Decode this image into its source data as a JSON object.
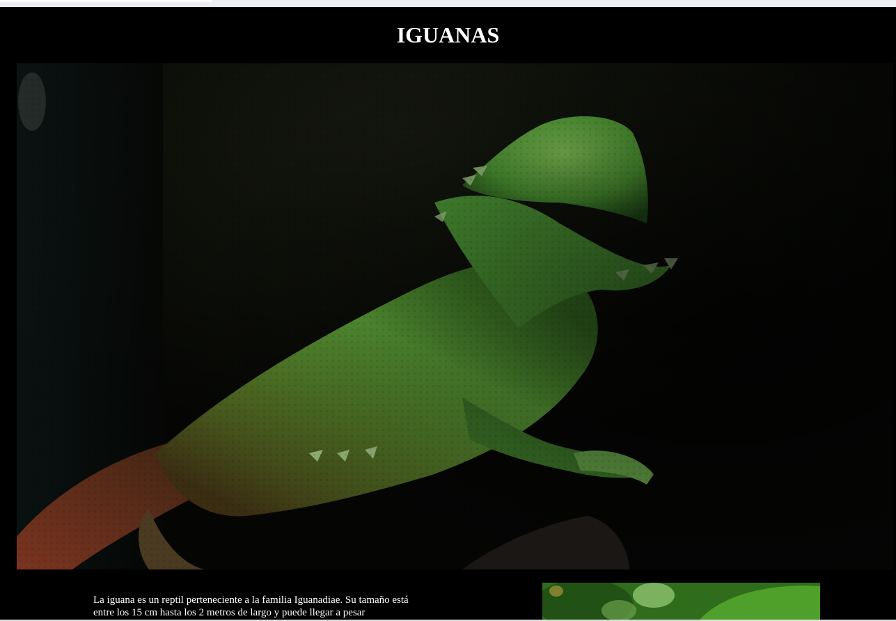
{
  "page": {
    "title": "IGUANAS",
    "intro_text": "La iguana es un reptil perteneciente a la familia Iguanadiae. Su tamaño está entre los 15 cm hasta los 2 metros de largo y puede llegar a pesar"
  },
  "images": {
    "hero": "green-iguana-photo",
    "side": "green-foliage-photo"
  },
  "colors": {
    "background": "#000000",
    "title": "#ffffff",
    "text": "#ffffff",
    "iguana_green": "#5aa53a",
    "tail_red": "#6a2a1a"
  }
}
